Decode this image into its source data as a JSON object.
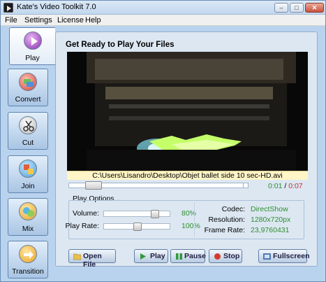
{
  "window": {
    "title": "Kate's Video Toolkit 7.0",
    "controls": {
      "minimize": "–",
      "maximize": "□",
      "close": "✕"
    }
  },
  "menu": [
    "File",
    "Settings",
    "License",
    "Help"
  ],
  "sidebar": {
    "items": [
      {
        "label": "Play",
        "icon": "play-icon",
        "active": true
      },
      {
        "label": "Convert",
        "icon": "convert-icon",
        "active": false
      },
      {
        "label": "Cut",
        "icon": "scissors-icon",
        "active": false
      },
      {
        "label": "Join",
        "icon": "join-icon",
        "active": false
      },
      {
        "label": "Mix",
        "icon": "mix-icon",
        "active": false
      },
      {
        "label": "Transition",
        "icon": "transition-arrow-icon",
        "active": false
      }
    ]
  },
  "main": {
    "title": "Get Ready to Play Your Files",
    "file_path": "C:\\Users\\Lisandro\\Desktop\\Objet ballet side 10 sec-HD.avi",
    "seek_position": 0.1,
    "time_current": "0:01",
    "time_separator": "/",
    "time_total": "0:07"
  },
  "options": {
    "title": "Play Options ...",
    "volume_label": "Volume:",
    "volume_value": 80,
    "volume_text": "80%",
    "rate_label": "Play Rate:",
    "rate_value": 100,
    "rate_text": "100%"
  },
  "info": {
    "codec_label": "Codec:",
    "codec_value": "DirectShow",
    "resolution_label": "Resolution:",
    "resolution_value": "1280x720px",
    "framerate_label": "Frame Rate:",
    "framerate_value": "23,9760431"
  },
  "buttons": {
    "open_file": "Open File",
    "play": "Play",
    "pause": "Pause",
    "stop": "Stop",
    "fullscreen": "Fullscreen"
  },
  "colors": {
    "green_text": "#2f8f2f",
    "red_text": "#c43030",
    "panel_bg": "#dce7f2",
    "window_bg": "#b9d3ee"
  }
}
